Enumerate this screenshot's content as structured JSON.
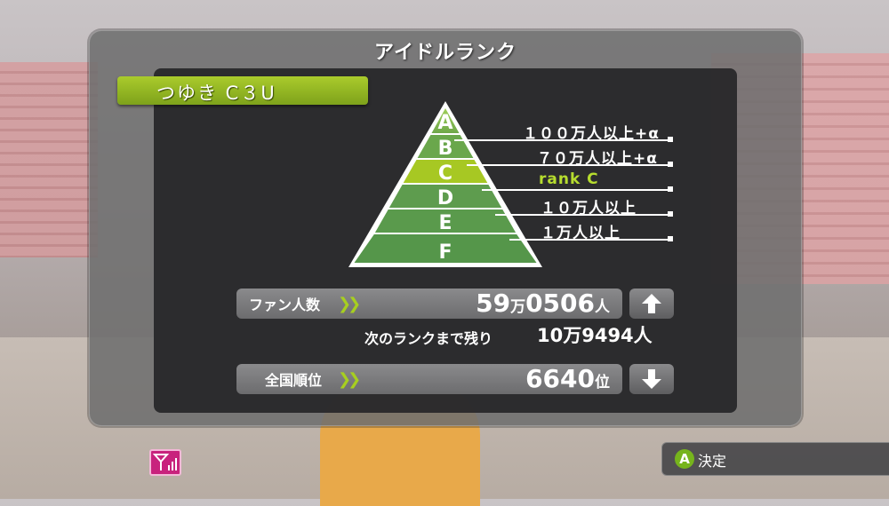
{
  "title": "アイドルランク",
  "idol_name": "つゆき C３U",
  "pyramid": {
    "tiers": [
      "A",
      "B",
      "C",
      "D",
      "E",
      "F"
    ],
    "current_tier": "C",
    "tier_colors": {
      "top": "#8dbb45",
      "current": "#a7c823",
      "normal": "#5a9a4c"
    }
  },
  "rank_labels": {
    "a": "１００万人以上+α",
    "b": "７０万人以上+α",
    "c": "rank  C",
    "d": "１０万人以上",
    "e": "１万人以上"
  },
  "fans": {
    "label": "ファン人数",
    "value_main": "59",
    "value_unit1": "万",
    "value_rest": "0506",
    "value_unit2": "人",
    "trend": "up"
  },
  "next_rank": {
    "label": "次のランクまで残り",
    "value": "10万9494人"
  },
  "national_rank": {
    "label": "全国順位",
    "value": "6640",
    "unit": "位",
    "trend": "down"
  },
  "footer": {
    "button_key": "A",
    "button_label": "決定"
  },
  "icons": {
    "arrows": "double-chevron-right-icon",
    "up": "arrow-up-icon",
    "down": "arrow-down-icon",
    "signal": "signal-icon"
  }
}
